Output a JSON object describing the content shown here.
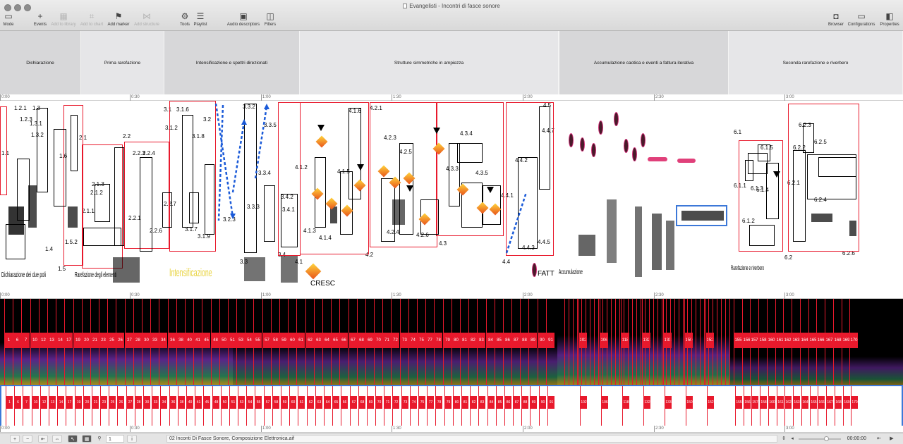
{
  "window": {
    "title": "Evangelisti - Incontri di fasce sonore",
    "document_icon": "document-icon"
  },
  "toolbar": {
    "mode": {
      "label": "Mode",
      "icon": "mode-icon"
    },
    "events": {
      "label": "Events",
      "icon": "plus-icon"
    },
    "add_to_library": {
      "label": "Add to library",
      "icon": "library-icon",
      "enabled": false
    },
    "add_to_chart": {
      "label": "Add to chart",
      "icon": "chart-icon",
      "enabled": false
    },
    "add_marker": {
      "label": "Add marker",
      "icon": "marker-flag-icon"
    },
    "add_structure": {
      "label": "Add structure",
      "icon": "structure-icon",
      "enabled": false
    },
    "tools": {
      "label": "Tools",
      "icon": "gear-icon"
    },
    "playlist": {
      "label": "Playlist",
      "icon": "list-icon"
    },
    "audio_descriptors": {
      "label": "Audio descriptors",
      "icon": "audio-descriptor-icon"
    },
    "filters": {
      "label": "Filters",
      "icon": "filter-icon"
    },
    "browser": {
      "label": "Browser",
      "icon": "browser-icon"
    },
    "configurations": {
      "label": "Configurations",
      "icon": "configuration-icon"
    },
    "properties": {
      "label": "Properties",
      "icon": "properties-icon"
    }
  },
  "sections": [
    {
      "label": "Dichiarazione"
    },
    {
      "label": "Prima rarefazione"
    },
    {
      "label": "Intensificazione e spettri direzionati"
    },
    {
      "label": "Strutture simmetriche in ampiezza"
    },
    {
      "label": ""
    },
    {
      "label": "Accumulazione caotica e eventi a fattura iterativa"
    },
    {
      "label": "Seconda rarefazione e riverbero"
    }
  ],
  "ruler": {
    "ticks": [
      "0:00",
      "0:30",
      "1:00",
      "1:30",
      "2:00",
      "2:30",
      "3:00"
    ]
  },
  "score": {
    "labels": [
      "1.1",
      "1.2.1",
      "1.2.3",
      "1.3",
      "1.3.1",
      "1.3.2",
      "1.4",
      "1.5",
      "1.5.2",
      "1.6",
      "2.1",
      "2.1.1",
      "2.1.2",
      "2.1.3",
      "2.2",
      "2.2.1",
      "2.2.3",
      "2.2.4",
      "2.2.6",
      "2.2.7",
      "3.1",
      "3.1.2",
      "3.1.6",
      "3.1.7",
      "3.1.8",
      "3.1.9",
      "3.2",
      "3.2.3",
      "3.3",
      "3.3.2",
      "3.3.3",
      "3.3.4",
      "3.3.5",
      "3.4",
      "3.4.1",
      "3.4.2",
      "4.1",
      "4.1.2",
      "4.1.3",
      "4.1.4",
      "4.1.5",
      "4.1.6",
      "4.2",
      "4.2.1",
      "4.2.3",
      "4.2.4",
      "4.2.5",
      "4.2.6",
      "4.3",
      "4.3.3",
      "4.3.4",
      "4.3.5",
      "4.4",
      "4.4.1",
      "4.4.2",
      "4.4.3",
      "4.4.5",
      "4.4.7",
      "4.5",
      "6.1",
      "6.1.1",
      "6.1.2",
      "6.1.3",
      "6.1.4",
      "6.1.5",
      "6.2",
      "6.2.1",
      "6.2.2",
      "6.2.3",
      "6.2.4",
      "6.2.5",
      "6.2.6"
    ],
    "annotations": {
      "cresc": "CRESC",
      "fatt": "FATT",
      "intensificazione": "Intensificazione",
      "dichiarazione": "Dichiarazione dei due poli",
      "rarefazione": "Rarefazione degli elementi",
      "accumulazione": "Accumulazione",
      "rarefazione2": "Rarefazione e riverbero"
    }
  },
  "markers": {
    "labels": [
      "1",
      "6",
      "7",
      "10",
      "12",
      "13",
      "14",
      "17",
      "19",
      "20",
      "21",
      "23",
      "25",
      "26",
      "27",
      "28",
      "30",
      "33",
      "34",
      "36",
      "38",
      "40",
      "41",
      "45",
      "48",
      "50",
      "51",
      "53",
      "54",
      "55",
      "57",
      "58",
      "59",
      "60",
      "61",
      "62",
      "63",
      "64",
      "65",
      "66",
      "67",
      "68",
      "69",
      "70",
      "71",
      "72",
      "73",
      "74",
      "75",
      "77",
      "78",
      "79",
      "80",
      "81",
      "82",
      "83",
      "84",
      "85",
      "86",
      "87",
      "88",
      "89",
      "90",
      "91",
      "102",
      "106",
      "118",
      "132",
      "133",
      "150",
      "152",
      "155",
      "156",
      "157",
      "158",
      "160",
      "161",
      "162",
      "163",
      "164",
      "165",
      "166",
      "167",
      "168",
      "169",
      "170"
    ],
    "color": "#e8192c"
  },
  "bottom_bar": {
    "file_name": "02 Inconti Di Fasce Sonore, Composizione Elettronica.aif",
    "page_field": "1",
    "timecode": "00:00:00"
  },
  "colors": {
    "accent_blue": "#3c78d8",
    "marker_red": "#e8192c",
    "section_gray": "#d7d7d9"
  }
}
